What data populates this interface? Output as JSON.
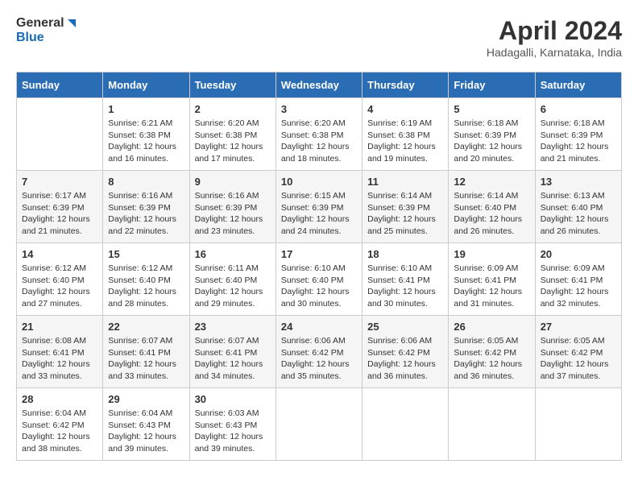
{
  "header": {
    "logo_line1": "General",
    "logo_line2": "Blue",
    "title": "April 2024",
    "subtitle": "Hadagalli, Karnataka, India"
  },
  "weekdays": [
    "Sunday",
    "Monday",
    "Tuesday",
    "Wednesday",
    "Thursday",
    "Friday",
    "Saturday"
  ],
  "weeks": [
    [
      {
        "day": "",
        "info": ""
      },
      {
        "day": "1",
        "info": "Sunrise: 6:21 AM\nSunset: 6:38 PM\nDaylight: 12 hours\nand 16 minutes."
      },
      {
        "day": "2",
        "info": "Sunrise: 6:20 AM\nSunset: 6:38 PM\nDaylight: 12 hours\nand 17 minutes."
      },
      {
        "day": "3",
        "info": "Sunrise: 6:20 AM\nSunset: 6:38 PM\nDaylight: 12 hours\nand 18 minutes."
      },
      {
        "day": "4",
        "info": "Sunrise: 6:19 AM\nSunset: 6:38 PM\nDaylight: 12 hours\nand 19 minutes."
      },
      {
        "day": "5",
        "info": "Sunrise: 6:18 AM\nSunset: 6:39 PM\nDaylight: 12 hours\nand 20 minutes."
      },
      {
        "day": "6",
        "info": "Sunrise: 6:18 AM\nSunset: 6:39 PM\nDaylight: 12 hours\nand 21 minutes."
      }
    ],
    [
      {
        "day": "7",
        "info": "Sunrise: 6:17 AM\nSunset: 6:39 PM\nDaylight: 12 hours\nand 21 minutes."
      },
      {
        "day": "8",
        "info": "Sunrise: 6:16 AM\nSunset: 6:39 PM\nDaylight: 12 hours\nand 22 minutes."
      },
      {
        "day": "9",
        "info": "Sunrise: 6:16 AM\nSunset: 6:39 PM\nDaylight: 12 hours\nand 23 minutes."
      },
      {
        "day": "10",
        "info": "Sunrise: 6:15 AM\nSunset: 6:39 PM\nDaylight: 12 hours\nand 24 minutes."
      },
      {
        "day": "11",
        "info": "Sunrise: 6:14 AM\nSunset: 6:39 PM\nDaylight: 12 hours\nand 25 minutes."
      },
      {
        "day": "12",
        "info": "Sunrise: 6:14 AM\nSunset: 6:40 PM\nDaylight: 12 hours\nand 26 minutes."
      },
      {
        "day": "13",
        "info": "Sunrise: 6:13 AM\nSunset: 6:40 PM\nDaylight: 12 hours\nand 26 minutes."
      }
    ],
    [
      {
        "day": "14",
        "info": "Sunrise: 6:12 AM\nSunset: 6:40 PM\nDaylight: 12 hours\nand 27 minutes."
      },
      {
        "day": "15",
        "info": "Sunrise: 6:12 AM\nSunset: 6:40 PM\nDaylight: 12 hours\nand 28 minutes."
      },
      {
        "day": "16",
        "info": "Sunrise: 6:11 AM\nSunset: 6:40 PM\nDaylight: 12 hours\nand 29 minutes."
      },
      {
        "day": "17",
        "info": "Sunrise: 6:10 AM\nSunset: 6:40 PM\nDaylight: 12 hours\nand 30 minutes."
      },
      {
        "day": "18",
        "info": "Sunrise: 6:10 AM\nSunset: 6:41 PM\nDaylight: 12 hours\nand 30 minutes."
      },
      {
        "day": "19",
        "info": "Sunrise: 6:09 AM\nSunset: 6:41 PM\nDaylight: 12 hours\nand 31 minutes."
      },
      {
        "day": "20",
        "info": "Sunrise: 6:09 AM\nSunset: 6:41 PM\nDaylight: 12 hours\nand 32 minutes."
      }
    ],
    [
      {
        "day": "21",
        "info": "Sunrise: 6:08 AM\nSunset: 6:41 PM\nDaylight: 12 hours\nand 33 minutes."
      },
      {
        "day": "22",
        "info": "Sunrise: 6:07 AM\nSunset: 6:41 PM\nDaylight: 12 hours\nand 33 minutes."
      },
      {
        "day": "23",
        "info": "Sunrise: 6:07 AM\nSunset: 6:41 PM\nDaylight: 12 hours\nand 34 minutes."
      },
      {
        "day": "24",
        "info": "Sunrise: 6:06 AM\nSunset: 6:42 PM\nDaylight: 12 hours\nand 35 minutes."
      },
      {
        "day": "25",
        "info": "Sunrise: 6:06 AM\nSunset: 6:42 PM\nDaylight: 12 hours\nand 36 minutes."
      },
      {
        "day": "26",
        "info": "Sunrise: 6:05 AM\nSunset: 6:42 PM\nDaylight: 12 hours\nand 36 minutes."
      },
      {
        "day": "27",
        "info": "Sunrise: 6:05 AM\nSunset: 6:42 PM\nDaylight: 12 hours\nand 37 minutes."
      }
    ],
    [
      {
        "day": "28",
        "info": "Sunrise: 6:04 AM\nSunset: 6:42 PM\nDaylight: 12 hours\nand 38 minutes."
      },
      {
        "day": "29",
        "info": "Sunrise: 6:04 AM\nSunset: 6:43 PM\nDaylight: 12 hours\nand 39 minutes."
      },
      {
        "day": "30",
        "info": "Sunrise: 6:03 AM\nSunset: 6:43 PM\nDaylight: 12 hours\nand 39 minutes."
      },
      {
        "day": "",
        "info": ""
      },
      {
        "day": "",
        "info": ""
      },
      {
        "day": "",
        "info": ""
      },
      {
        "day": "",
        "info": ""
      }
    ]
  ]
}
